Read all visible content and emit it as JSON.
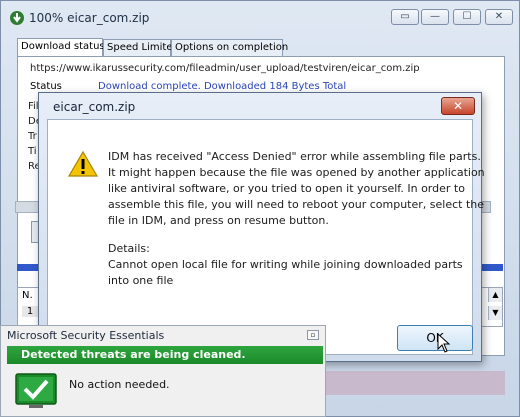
{
  "idm": {
    "title": "100% eicar_com.zip",
    "tabs": [
      "Download status",
      "Speed Limiter",
      "Options on completion"
    ],
    "url": "https://www.ikarussecurity.com/fileadmin/user_upload/testviren/eicar_com.zip",
    "status_label": "Status",
    "status_value": "Download complete. Downloaded 184 Bytes Total",
    "cut_labels": [
      "File",
      "De",
      "Tr",
      "Ti",
      "Re"
    ],
    "table": {
      "header": "N.",
      "row": "1"
    }
  },
  "dialog": {
    "title": "eicar_com.zip",
    "close_label": "✕",
    "lines": [
      "IDM has received \"Access Denied\" error while assembling file parts.",
      "It might happen because the file was opened by another application",
      "like antiviral software, or you tried to open it yourself. In order to",
      "assemble this file, you will need to reboot your computer, select the",
      "file in IDM, and press on resume button."
    ],
    "details_label": "Details:",
    "details_lines": [
      "Cannot open local file for writing while joining downloaded parts",
      "into one file"
    ],
    "ok_label": "OK"
  },
  "mse": {
    "title": "Microsoft Security Essentials",
    "banner": "Detected threats are being cleaned.",
    "status": "No action needed."
  },
  "colors": {
    "status_blue": "#2b46b8",
    "mse_green": "#1b8a2a",
    "dialog_close_red": "#c8452c"
  },
  "icons": [
    "idm-app-icon",
    "warning-icon",
    "check-shield-icon",
    "mouse-cursor-icon"
  ]
}
